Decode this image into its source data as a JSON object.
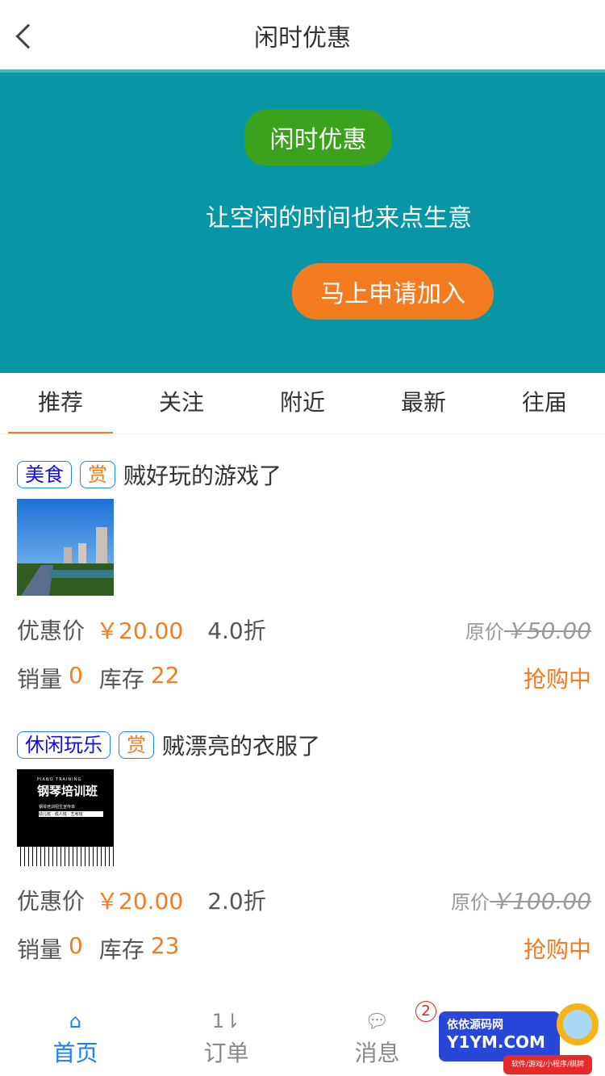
{
  "header": {
    "title": "闲时优惠"
  },
  "banner": {
    "badge": "闲时优惠",
    "slogan": "让空闲的时间也来点生意",
    "cta": "马上申请加入",
    "bg_color": "#0895a5"
  },
  "tabs": [
    {
      "label": "推荐",
      "active": true
    },
    {
      "label": "关注"
    },
    {
      "label": "附近"
    },
    {
      "label": "最新"
    },
    {
      "label": "往届"
    }
  ],
  "items": [
    {
      "category": "美食",
      "reward": "赏",
      "title": "贼好玩的游戏了",
      "price_label": "优惠价",
      "price": "￥20.00",
      "discount": "4.0折",
      "orig_label": "原价",
      "orig_price": "￥50.00",
      "sales_label": "销量",
      "sales": "0",
      "stock_label": "库存",
      "stock": "22",
      "status": "抢购中"
    },
    {
      "category": "休闲玩乐",
      "reward": "赏",
      "title": "贼漂亮的衣服了",
      "price_label": "优惠价",
      "price": "￥20.00",
      "discount": "2.0折",
      "orig_label": "原价",
      "orig_price": "￥100.00",
      "sales_label": "销量",
      "sales": "0",
      "stock_label": "库存",
      "stock": "23",
      "status": "抢购中",
      "image_text": {
        "en": "PIANO TRAINING",
        "title": "钢琴培训班",
        "sub": "钢琴培训招生宣传单",
        "classes": "幼儿班 · 成人班 · 艺考班"
      }
    }
  ],
  "nav": [
    {
      "label": "首页",
      "icon": "home-icon",
      "active": true
    },
    {
      "label": "订单",
      "icon": "sort-icon"
    },
    {
      "label": "消息",
      "icon": "message-icon",
      "badge": "2"
    }
  ],
  "ad": {
    "name": "依依源码网",
    "domain": "Y1YM.COM",
    "tagline": "软件/游戏/小程序/棋牌"
  }
}
